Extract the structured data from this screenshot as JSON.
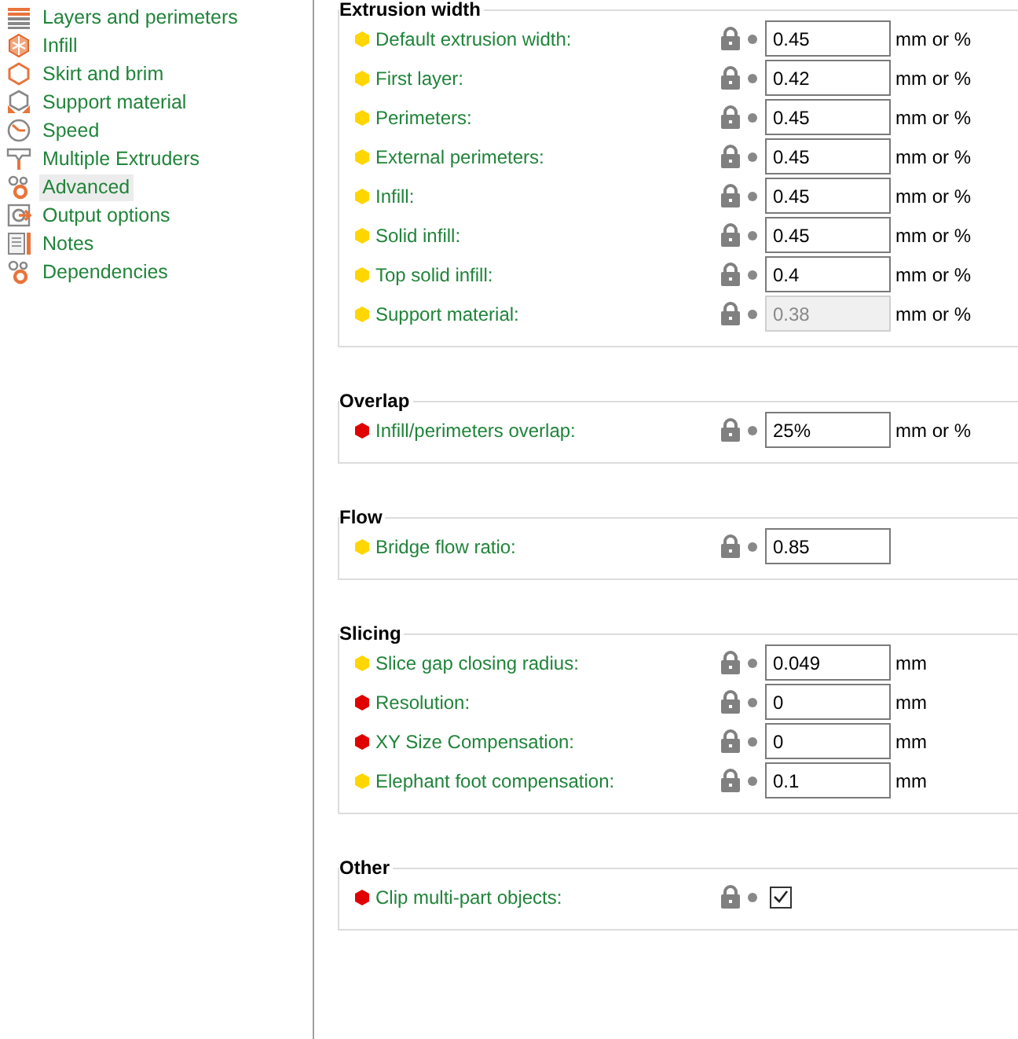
{
  "sidebar": {
    "items": [
      {
        "label": "Layers and perimeters",
        "kind": "layers",
        "selected": false
      },
      {
        "label": "Infill",
        "kind": "infill",
        "selected": false
      },
      {
        "label": "Skirt and brim",
        "kind": "skirt",
        "selected": false
      },
      {
        "label": "Support material",
        "kind": "support",
        "selected": false
      },
      {
        "label": "Speed",
        "kind": "speed",
        "selected": false
      },
      {
        "label": "Multiple Extruders",
        "kind": "extruder",
        "selected": false
      },
      {
        "label": "Advanced",
        "kind": "gears",
        "selected": true
      },
      {
        "label": "Output options",
        "kind": "output",
        "selected": false
      },
      {
        "label": "Notes",
        "kind": "notes",
        "selected": false
      },
      {
        "label": "Dependencies",
        "kind": "gears",
        "selected": false
      }
    ]
  },
  "groups": [
    {
      "title": "Extrusion width",
      "options": [
        {
          "label": "Default extrusion width:",
          "color": "#ffd600",
          "kind": "text",
          "value": "0.45",
          "unit": "mm or %",
          "disabled": false
        },
        {
          "label": "First layer:",
          "color": "#ffd600",
          "kind": "text",
          "value": "0.42",
          "unit": "mm or %",
          "disabled": false
        },
        {
          "label": "Perimeters:",
          "color": "#ffd600",
          "kind": "text",
          "value": "0.45",
          "unit": "mm or %",
          "disabled": false
        },
        {
          "label": "External perimeters:",
          "color": "#ffd600",
          "kind": "text",
          "value": "0.45",
          "unit": "mm or %",
          "disabled": false
        },
        {
          "label": "Infill:",
          "color": "#ffd600",
          "kind": "text",
          "value": "0.45",
          "unit": "mm or %",
          "disabled": false
        },
        {
          "label": "Solid infill:",
          "color": "#ffd600",
          "kind": "text",
          "value": "0.45",
          "unit": "mm or %",
          "disabled": false
        },
        {
          "label": "Top solid infill:",
          "color": "#ffd600",
          "kind": "text",
          "value": "0.4",
          "unit": "mm or %",
          "disabled": false
        },
        {
          "label": "Support material:",
          "color": "#ffd600",
          "kind": "text",
          "value": "0.38",
          "unit": "mm or %",
          "disabled": true
        }
      ]
    },
    {
      "title": "Overlap",
      "options": [
        {
          "label": "Infill/perimeters overlap:",
          "color": "#e00000",
          "kind": "text",
          "value": "25%",
          "unit": "mm or %",
          "disabled": false
        }
      ]
    },
    {
      "title": "Flow",
      "options": [
        {
          "label": "Bridge flow ratio:",
          "color": "#ffd600",
          "kind": "text",
          "value": "0.85",
          "disabled": false
        }
      ]
    },
    {
      "title": "Slicing",
      "options": [
        {
          "label": "Slice gap closing radius:",
          "color": "#ffd600",
          "kind": "text",
          "value": "0.049",
          "unit": "mm",
          "disabled": false
        },
        {
          "label": "Resolution:",
          "color": "#e00000",
          "kind": "text",
          "value": "0",
          "unit": "mm",
          "disabled": false
        },
        {
          "label": "XY Size Compensation:",
          "color": "#e00000",
          "kind": "text",
          "value": "0",
          "unit": "mm",
          "disabled": false
        },
        {
          "label": "Elephant foot compensation:",
          "color": "#ffd600",
          "kind": "text",
          "value": "0.1",
          "unit": "mm",
          "disabled": false
        }
      ]
    },
    {
      "title": "Other",
      "options": [
        {
          "label": "Clip multi-part objects:",
          "color": "#e00000",
          "kind": "checkbox",
          "checked": true
        }
      ]
    }
  ]
}
